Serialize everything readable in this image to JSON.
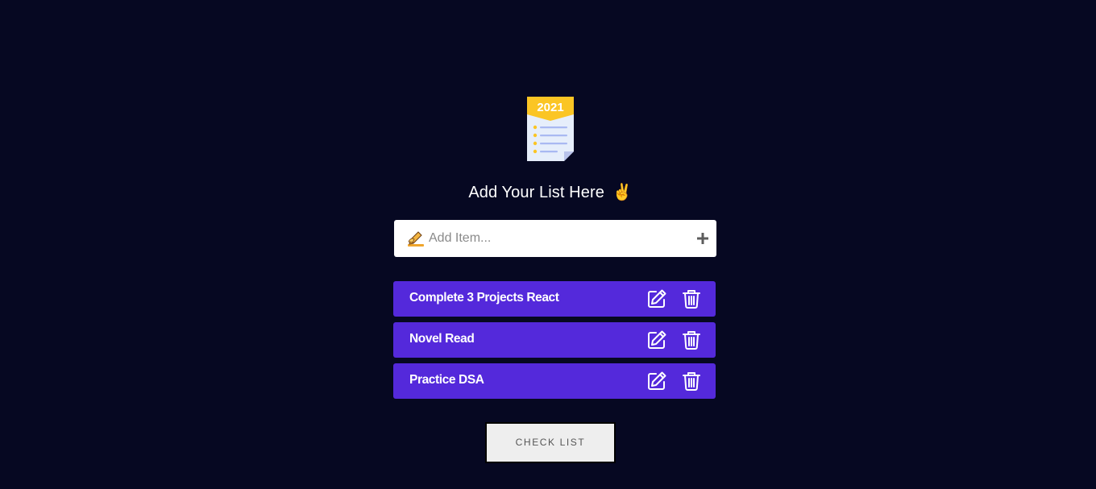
{
  "header": {
    "logo_year": "2021",
    "logo_icon": "checklist-icon",
    "title": "Add Your List Here",
    "title_emoji": "✌"
  },
  "add_item": {
    "placeholder": "Add Item...",
    "value": "",
    "leading_icon": "writing-hand-icon",
    "add_icon": "plus-icon"
  },
  "items": [
    {
      "label": "Complete 3 Projects React",
      "edit_icon": "edit-icon",
      "delete_icon": "trash-icon"
    },
    {
      "label": "Novel Read",
      "edit_icon": "edit-icon",
      "delete_icon": "trash-icon"
    },
    {
      "label": "Practice DSA",
      "edit_icon": "edit-icon",
      "delete_icon": "trash-icon"
    }
  ],
  "check_list_button": "CHECK LIST",
  "colors": {
    "background": "#060822",
    "item_background": "#5429db",
    "logo_banner": "#fbc524",
    "button_background": "#eeeeee"
  }
}
